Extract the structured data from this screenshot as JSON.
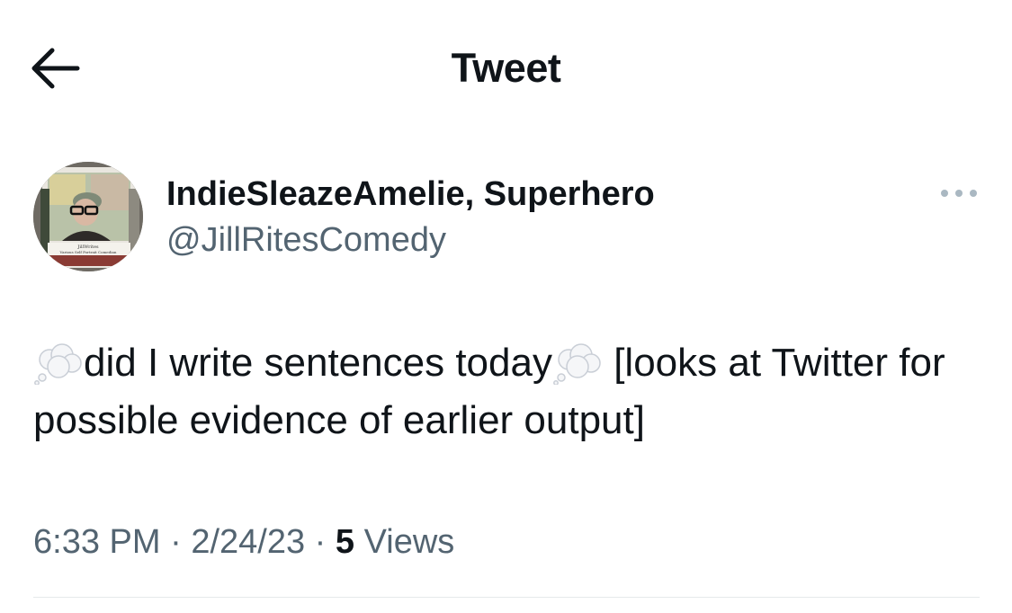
{
  "header": {
    "title": "Tweet",
    "back_icon": "arrow-left-icon"
  },
  "author": {
    "display_name": "IndieSleazeAmelie, Superhero",
    "handle": "@JillRitesComedy",
    "avatar_caption_line1": "JillWrites",
    "avatar_caption_line2": "Various Self Portrait Comedian",
    "more_icon": "more-dots-icon"
  },
  "tweet": {
    "segment_1": "did I write sentences today",
    "segment_2": "[looks at Twitter for possible evidence of earlier output]",
    "emoji_icon": "thought-balloon-icon"
  },
  "meta": {
    "time": "6:33 PM",
    "separator": "·",
    "date": "2/24/23",
    "views_count": "5",
    "views_label": "Views"
  },
  "colors": {
    "text_primary": "#0f1419",
    "text_secondary": "#536471",
    "divider": "#e6e9eb",
    "icon_muted": "#aab8c2"
  }
}
